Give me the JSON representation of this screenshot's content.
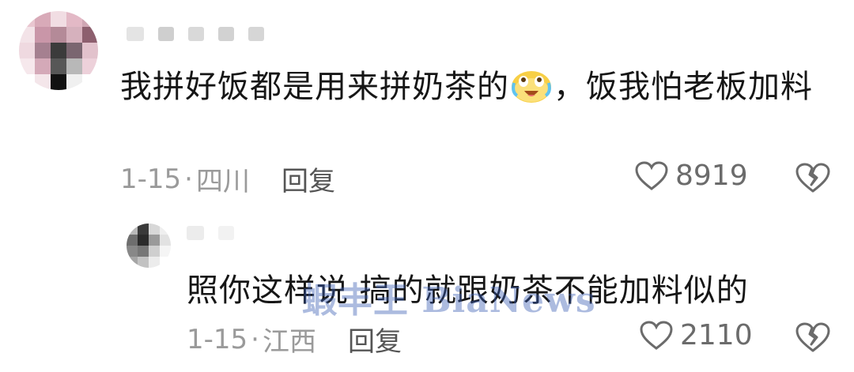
{
  "comment": {
    "text_before_emoji": "我拼好饭都是用来拼奶茶的",
    "emoji": "crying-laughing-emoji",
    "text_after_emoji": "，饭我怕老板加料",
    "date": "1-15",
    "separator": "·",
    "location": "四川",
    "reply_label": "回复",
    "like_count": "8919"
  },
  "reply": {
    "text": "照你这样说 搞的就跟奶茶不能加料似的",
    "date": "1-15",
    "separator": "·",
    "location": "江西",
    "reply_label": "回复",
    "like_count": "2110"
  },
  "watermark": {
    "text": "蝦丰王 BiaNews"
  },
  "colors": {
    "text": "#161616",
    "meta": "#9a9a9a",
    "watermark": "#3b5fb5"
  }
}
